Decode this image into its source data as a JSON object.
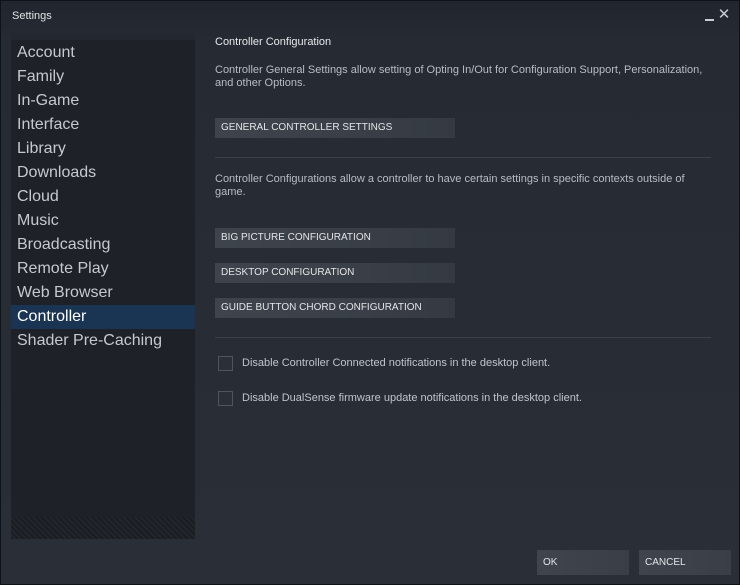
{
  "window": {
    "title": "Settings",
    "minimize_icon": "minimize-icon",
    "close_icon": "close-icon",
    "close_glyph": "✕"
  },
  "sidebar": {
    "items": [
      {
        "label": "Account",
        "active": false
      },
      {
        "label": "Family",
        "active": false
      },
      {
        "label": "In-Game",
        "active": false
      },
      {
        "label": "Interface",
        "active": false
      },
      {
        "label": "Library",
        "active": false
      },
      {
        "label": "Downloads",
        "active": false
      },
      {
        "label": "Cloud",
        "active": false
      },
      {
        "label": "Music",
        "active": false
      },
      {
        "label": "Broadcasting",
        "active": false
      },
      {
        "label": "Remote Play",
        "active": false
      },
      {
        "label": "Web Browser",
        "active": false
      },
      {
        "label": "Controller",
        "active": true
      },
      {
        "label": "Shader Pre-Caching",
        "active": false
      }
    ]
  },
  "main": {
    "section_title": "Controller Configuration",
    "general_description": "Controller General Settings allow setting of Opting In/Out for Configuration Support, Personalization, and other Options.",
    "general_button": "GENERAL CONTROLLER SETTINGS",
    "configs_description": "Controller Configurations allow a controller to have certain settings in specific contexts outside of game.",
    "config_buttons": {
      "big_picture": "BIG PICTURE CONFIGURATION",
      "desktop": "DESKTOP CONFIGURATION",
      "guide_chord": "GUIDE BUTTON CHORD CONFIGURATION"
    },
    "checkboxes": [
      {
        "label": "Disable Controller Connected notifications in the desktop client.",
        "checked": false
      },
      {
        "label": "Disable DualSense firmware update notifications in the desktop client.",
        "checked": false
      }
    ]
  },
  "footer": {
    "ok_label": "OK",
    "cancel_label": "CANCEL"
  },
  "colors": {
    "active_nav": "#1a3553",
    "window_bg": "#2a2e36",
    "sidebar_bg": "#1e2127",
    "button_bg": "#3f444c"
  }
}
